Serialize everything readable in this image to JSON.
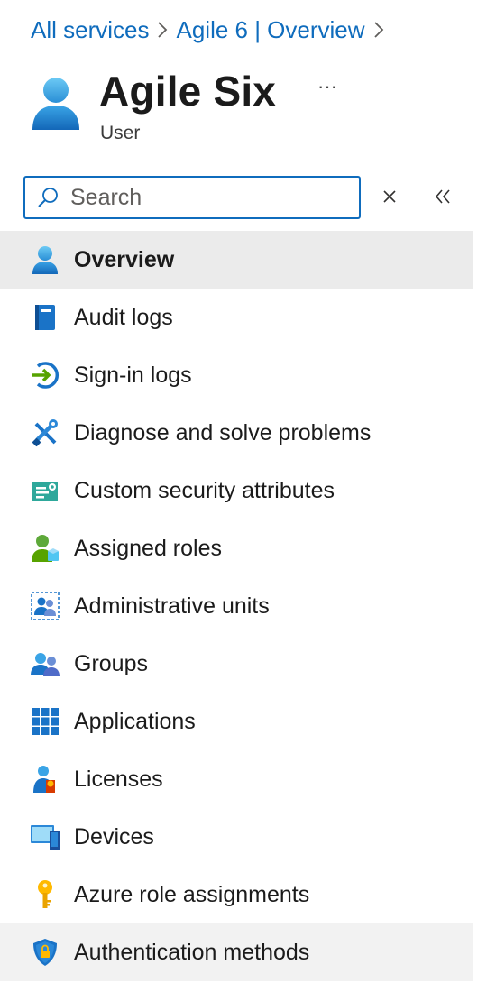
{
  "breadcrumb": {
    "items": [
      "All services",
      "Agile 6 | Overview"
    ]
  },
  "header": {
    "title": "Agile Six",
    "subtitle": "User",
    "more_label": "···"
  },
  "search": {
    "placeholder": "Search",
    "value": ""
  },
  "nav": {
    "items": [
      {
        "label": "Overview",
        "icon": "user-icon",
        "state": "selected"
      },
      {
        "label": "Audit logs",
        "icon": "audit-log-book-icon"
      },
      {
        "label": "Sign-in logs",
        "icon": "sign-in-arrow-icon"
      },
      {
        "label": "Diagnose and solve problems",
        "icon": "wrench-screwdriver-icon"
      },
      {
        "label": "Custom security attributes",
        "icon": "security-attributes-icon"
      },
      {
        "label": "Assigned roles",
        "icon": "assigned-roles-icon"
      },
      {
        "label": "Administrative units",
        "icon": "administrative-units-icon"
      },
      {
        "label": "Groups",
        "icon": "groups-icon"
      },
      {
        "label": "Applications",
        "icon": "applications-grid-icon"
      },
      {
        "label": "Licenses",
        "icon": "licenses-icon"
      },
      {
        "label": "Devices",
        "icon": "devices-icon"
      },
      {
        "label": "Azure role assignments",
        "icon": "key-icon"
      },
      {
        "label": "Authentication methods",
        "icon": "shield-lock-icon",
        "state": "hover"
      }
    ]
  },
  "colors": {
    "link": "#0f6cbd",
    "selected_background": "#ebebeb",
    "hover_background": "#f2f2f2"
  }
}
